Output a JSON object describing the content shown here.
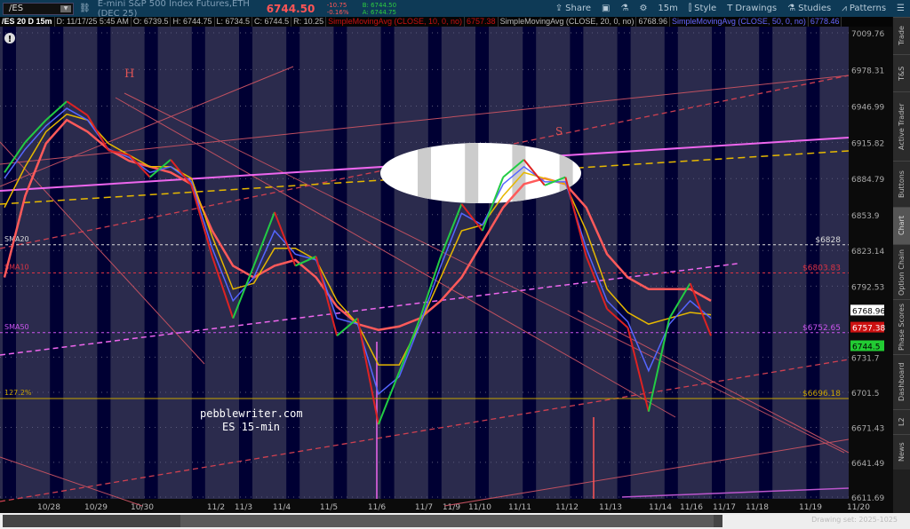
{
  "toolbar": {
    "symbol": "/ES",
    "description": "E-mini S&P 500 Index Futures,ETH (DEC 25)",
    "last": "6744.50",
    "change": "-10.75",
    "change_pct": "-0.16%",
    "bid": "B: 6744.50",
    "ask": "A: 6744.75",
    "buttons": [
      {
        "label": "Share",
        "icon": "share-icon"
      },
      {
        "label": "",
        "icon": "alert-icon"
      },
      {
        "label": "",
        "icon": "flask-icon"
      },
      {
        "label": "",
        "icon": "gear-icon"
      },
      {
        "label": "15m",
        "icon": ""
      },
      {
        "label": "Style",
        "icon": "candle-icon"
      },
      {
        "label": "Drawings",
        "icon": "text-t-icon"
      },
      {
        "label": "Studies",
        "icon": "flask-icon"
      },
      {
        "label": "Patterns",
        "icon": "pattern-icon"
      },
      {
        "label": "",
        "icon": "menu-icon"
      }
    ]
  },
  "studybar": {
    "symbol": "/ES 20 D 15m",
    "date": "D: 11/17/25 5:45 AM",
    "open": "O: 6739.5",
    "high": "H: 6744.75",
    "low": "L: 6734.5",
    "close": "C: 6744.5",
    "range": "R: 10.25",
    "sma10_label": "SimpleMovingAvg (CLOSE, 10, 0, no)",
    "sma10_value": "6757.38",
    "sma20_label": "SimpleMovingAvg (CLOSE, 20, 0, no)",
    "sma20_value": "6768.96",
    "sma50_label": "SimpleMovingAvg (CLOSE, 50, 0, no)",
    "sma50_value": "6778.46"
  },
  "sidebar": [
    "Trade",
    "T&S",
    "Active Trader",
    "Buttons",
    "Chart",
    "Option Chain",
    "Phase Scores",
    "Dashboard",
    "L2",
    "News"
  ],
  "sidebar_active": "Chart",
  "scroll": {
    "drawing_set": "Drawing set: 2025-1025"
  },
  "colors": {
    "up": "#22cc44",
    "down": "#dd2222",
    "sma_red": "#ff5a5a",
    "sma_yellow": "#e6b800",
    "sma_blue": "#5566ff",
    "magenta": "#ee66ee",
    "bg_dark": "#000033",
    "bg_light": "#2b2b4d"
  },
  "chart_data": {
    "type": "line",
    "yticks": [
      "7009.76",
      "6978.31",
      "6946.99",
      "6915.82",
      "6884.79",
      "6853.9",
      "6823.14",
      "6792.53",
      "6731.7",
      "6701.5",
      "6671.43",
      "6641.49",
      "6611.69"
    ],
    "ylim": [
      6611.69,
      7009.76
    ],
    "xticks": [
      "10/28",
      "10/29",
      "10/30",
      "11/2",
      "11/3",
      "11/4",
      "11/5",
      "11/6",
      "11/7",
      "11/9",
      "11/10",
      "11/11",
      "11/12",
      "11/13",
      "11/14",
      "11/16",
      "11/17",
      "11/18",
      "11/19",
      "11/20"
    ],
    "price": [
      6890,
      6916,
      6935,
      6951,
      6939,
      6909,
      6905,
      6886,
      6901,
      6879,
      6818,
      6765,
      6810,
      6856,
      6810,
      6818,
      6750,
      6765,
      6674,
      6719,
      6765,
      6818,
      6863,
      6840,
      6886,
      6901,
      6879,
      6886,
      6818,
      6773,
      6757,
      6685,
      6765,
      6795,
      6750
    ],
    "sma_red": [
      6800,
      6870,
      6915,
      6935,
      6925,
      6910,
      6900,
      6895,
      6890,
      6880,
      6840,
      6810,
      6800,
      6810,
      6815,
      6800,
      6775,
      6760,
      6755,
      6758,
      6765,
      6780,
      6800,
      6830,
      6860,
      6880,
      6885,
      6880,
      6860,
      6820,
      6800,
      6790,
      6790,
      6790,
      6780
    ],
    "sma_yellow": [
      6860,
      6895,
      6925,
      6940,
      6935,
      6915,
      6905,
      6895,
      6895,
      6885,
      6835,
      6790,
      6795,
      6825,
      6825,
      6815,
      6780,
      6760,
      6725,
      6725,
      6760,
      6800,
      6840,
      6845,
      6870,
      6890,
      6885,
      6880,
      6840,
      6790,
      6770,
      6760,
      6765,
      6770,
      6768
    ],
    "sma_blue": [
      6885,
      6910,
      6930,
      6945,
      6935,
      6910,
      6903,
      6890,
      6895,
      6882,
      6825,
      6780,
      6800,
      6840,
      6820,
      6815,
      6765,
      6760,
      6700,
      6715,
      6760,
      6810,
      6855,
      6845,
      6880,
      6895,
      6882,
      6882,
      6825,
      6780,
      6762,
      6720,
      6760,
      6780,
      6765
    ],
    "levels": [
      {
        "label": "SMA20",
        "value": 6828,
        "text": "$6828",
        "color": "#dddddd"
      },
      {
        "label": "SMA10",
        "value": 6803.83,
        "text": "$6803.83",
        "color": "#dd3344"
      },
      {
        "label": "SMA50",
        "value": 6752.65,
        "text": "$6752.65",
        "color": "#cc55ee"
      },
      {
        "label": "127.2%",
        "value": 6696.18,
        "text": "$6696.18",
        "color": "#c9a400"
      }
    ],
    "price_tags": [
      {
        "text": "6768.96",
        "bg": "#ffffff",
        "fg": "#000000",
        "value": 6768.96
      },
      {
        "text": "6757.38",
        "bg": "#cc1111",
        "fg": "#ffffff",
        "value": 6757.38
      },
      {
        "text": "6744.5",
        "bg": "#22cc33",
        "fg": "#000000",
        "value": 6744.5
      }
    ],
    "annotations": {
      "h": "H",
      "s": "S",
      "watermark1": "pebblewriter.com",
      "watermark2": "ES 15-min"
    }
  }
}
